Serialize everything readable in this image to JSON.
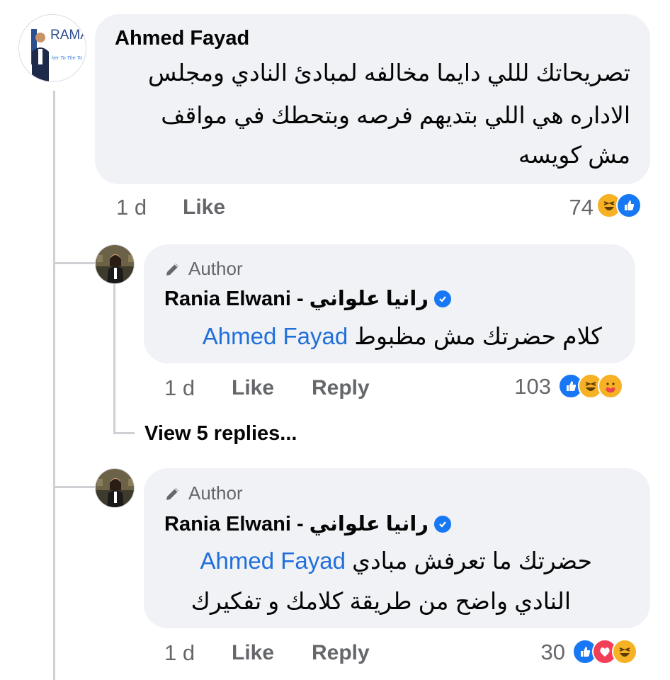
{
  "comment": {
    "author": "Ahmed Fayad",
    "avatar_logo_text": "RAMA",
    "avatar_logo_tagline": "her To The To",
    "text_lines": [
      "تصريحاتك لللي دايما مخالفه لمبادئ النادي ومجلس",
      "الاداره هي اللي بتديهم فرصه وبتحطك في مواقف",
      "مش كويسه"
    ],
    "time": "1 d",
    "like_label": "Like",
    "reaction_count": "74",
    "reaction_icons": [
      "haha-icon",
      "like-icon"
    ]
  },
  "replies": [
    {
      "badge": "Author",
      "author": "Rania Elwani - رانيا علواني",
      "mention": "Ahmed Fayad",
      "text_lines": [
        "كلام حضرتك مش مظبوط"
      ],
      "time": "1 d",
      "like_label": "Like",
      "reply_label": "Reply",
      "reaction_count": "103",
      "reaction_icons": [
        "like-icon",
        "haha-icon",
        "care-icon"
      ]
    },
    {
      "badge": "Author",
      "author": "Rania Elwani - رانيا علواني",
      "mention": "Ahmed Fayad",
      "text_lines": [
        "حضرتك ما تعرفش مبادي",
        "النادي واضح من طريقة كلامك و تفكيرك"
      ],
      "time": "1 d",
      "like_label": "Like",
      "reply_label": "Reply",
      "reaction_count": "30",
      "reaction_icons": [
        "like-icon",
        "love-icon",
        "haha-icon"
      ]
    }
  ],
  "view_replies_label": "View 5 replies...",
  "colors": {
    "bubble": "#f0f2f5",
    "secondary_text": "#65676b",
    "mention": "#216fdb",
    "like_blue": "#1877f2",
    "love_red": "#f33e58",
    "haha_yellow": "#f7b125"
  }
}
